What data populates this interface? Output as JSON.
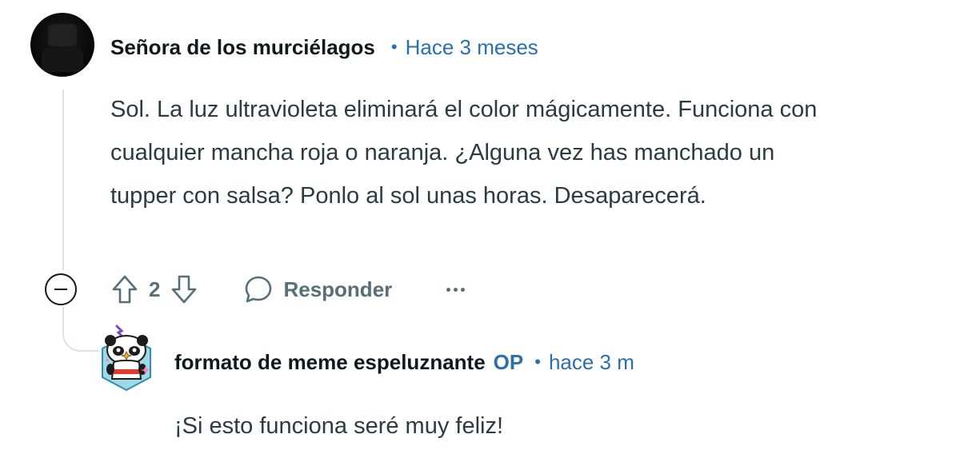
{
  "comment": {
    "author": "Señora de los murciélagos",
    "separator": "•",
    "time": "Hace 3 meses",
    "body": "Sol. La luz ultravioleta eliminará el color mágicamente. Funciona con cualquier mancha roja o naranja. ¿Alguna vez has manchado un tupper con salsa? Ponlo al sol unas horas. Desaparecerá.",
    "score": "2",
    "reply_label": "Responder",
    "icons": {
      "collapse": "collapse-minus-icon",
      "upvote": "upvote-arrow-icon",
      "downvote": "downvote-arrow-icon",
      "reply": "speech-bubble-icon",
      "more": "more-dots-icon"
    },
    "colors": {
      "meta": "#2a6fb0",
      "text": "#2a3c42",
      "muted": "#576f76"
    }
  },
  "reply": {
    "author": "formato de meme espeluznante",
    "op_badge": "OP",
    "separator": "•",
    "time": "hace 3 m",
    "body": "¡Si esto funciona seré muy feliz!"
  }
}
